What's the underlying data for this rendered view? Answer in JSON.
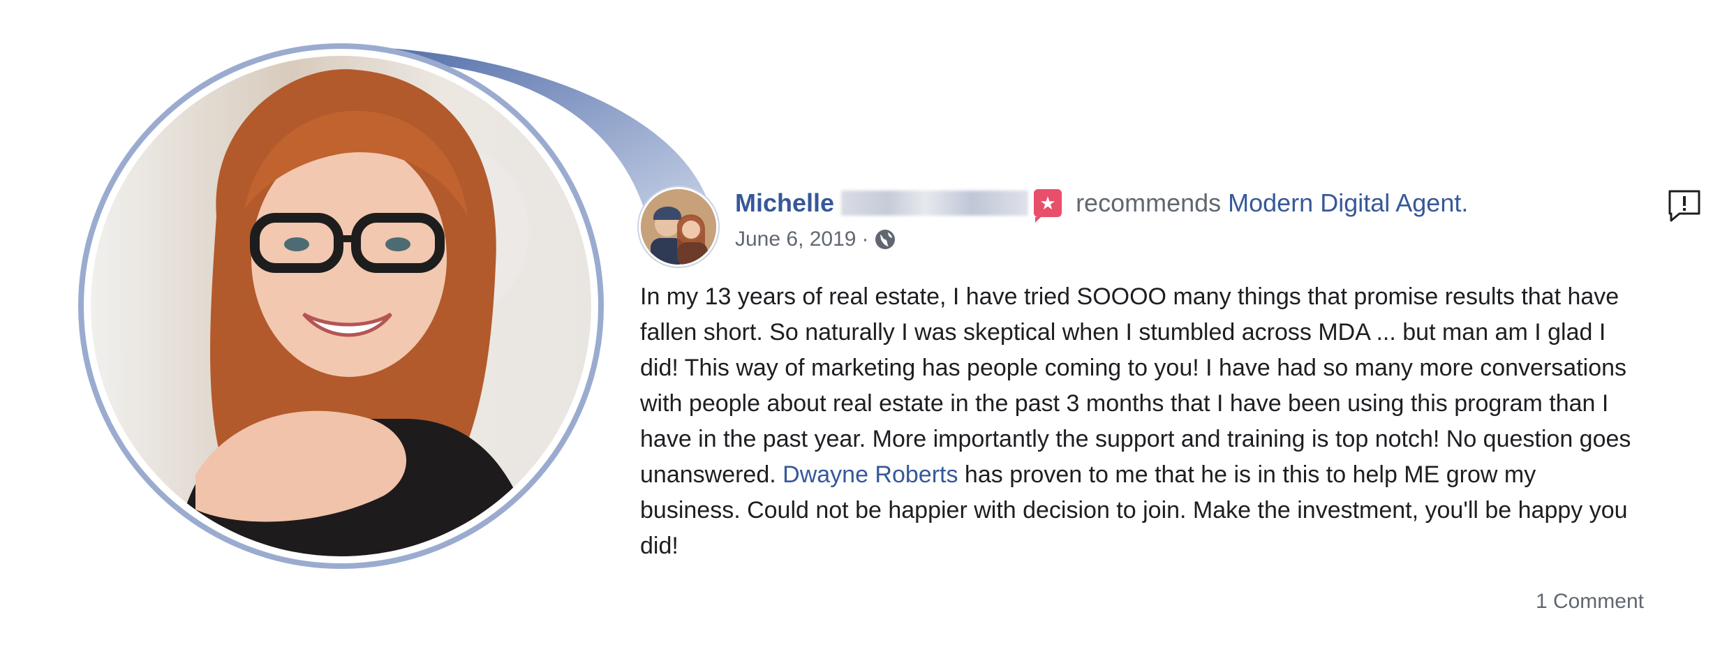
{
  "post": {
    "author_first": "Michelle",
    "recommends_text": "recommends",
    "page_name": "Modern Digital Agent.",
    "date": "June 6, 2019",
    "date_separator": "·",
    "body_part1": "In my 13 years of real estate, I have tried SOOOO many things that promise results that have fallen short. So naturally I was skeptical when I stumbled across MDA ... but man am I glad I did! This way of marketing has people coming to you! I have had so many more conversations with people about real estate in the past 3 months that I have been using this program than I have in the past year. More importantly the support and training is top notch! No question goes unanswered. ",
    "tagged_person": "Dwayne Roberts",
    "body_part2": " has proven to me that he is in this to help ME grow my business. Could not be happier with decision to join. Make the investment, you'll be happy you did!",
    "comments": "1 Comment",
    "more_glyph": "•••"
  },
  "icons": {
    "badge": "recommendation-star-icon",
    "globe": "globe-icon",
    "report": "report-icon",
    "more": "more-icon"
  },
  "colors": {
    "link": "#365899",
    "meta": "#606770",
    "ring": "#9aabcf",
    "badge": "#e84f6a"
  }
}
